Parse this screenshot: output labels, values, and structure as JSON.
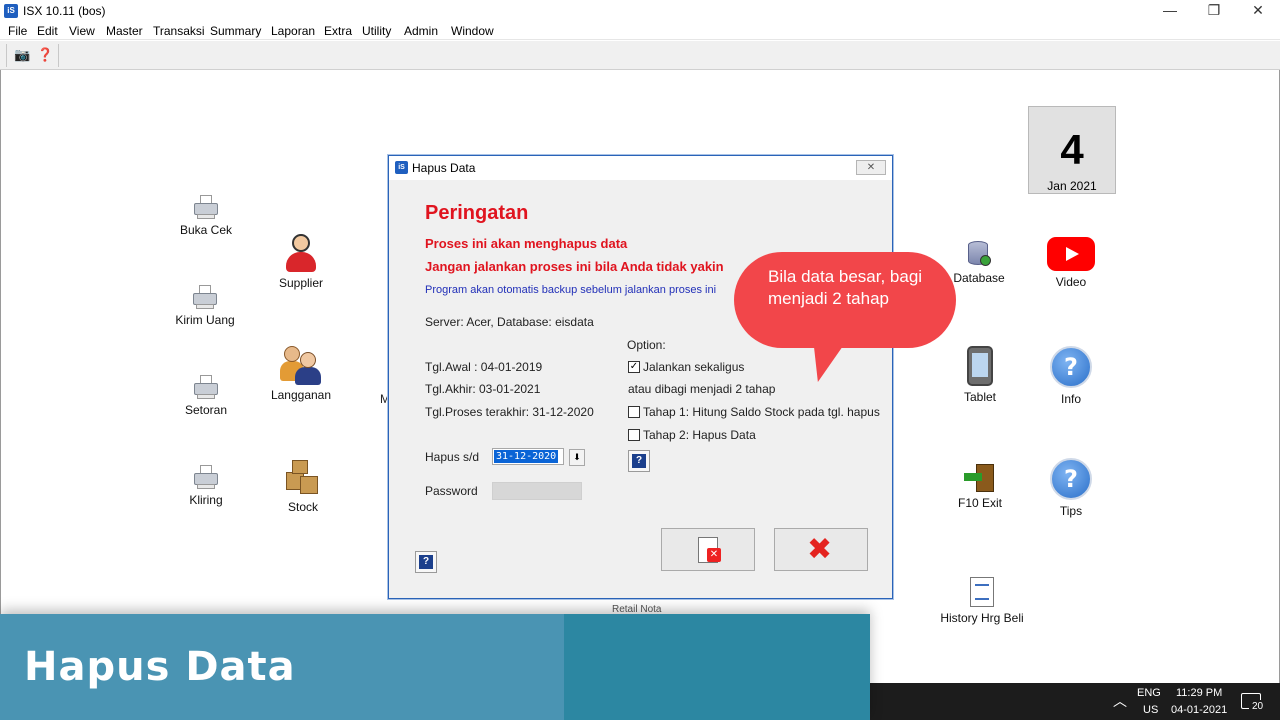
{
  "window": {
    "app_icon": "iS",
    "title": "ISX 10.11 (bos)",
    "minimize": "—",
    "restore": "❐",
    "close": "✕"
  },
  "menu": [
    "File",
    "Edit",
    "View",
    "Master",
    "Transaksi",
    "Summary",
    "Laporan",
    "Extra",
    "Utility",
    "Admin",
    "Window"
  ],
  "toolbar": {
    "icons": [
      "camera-icon",
      "help-key-icon"
    ]
  },
  "desktop_icons": {
    "buka_cek": "Buka Cek",
    "kirim_uang": "Kirim Uang",
    "setoran": "Setoran",
    "kliring": "Kliring",
    "supplier": "Supplier",
    "langganan": "Langganan",
    "stock": "Stock",
    "partial_m": "M",
    "partial_bottom": "Retail Nota",
    "database": "Database",
    "video": "Video",
    "tablet": "Tablet",
    "info": "Info",
    "exit": "F10  Exit",
    "tips": "Tips",
    "history": "History Hrg Beli"
  },
  "date_tile": {
    "day": "4",
    "month_year": "Jan 2021"
  },
  "dialog": {
    "icon": "iS",
    "title": "Hapus Data",
    "close": "✕",
    "heading": "Peringatan",
    "warning1": "Proses ini akan menghapus data",
    "warning2": "Jangan jalankan proses ini bila Anda tidak yakin",
    "note": "Program akan otomatis backup sebelum jalankan proses ini",
    "server": "Server: Acer,  Database: eisdata",
    "tgl_awal": "Tgl.Awal : 04-01-2019",
    "tgl_akhir": "Tgl.Akhir: 03-01-2021",
    "tgl_proses": "Tgl.Proses terakhir:  31-12-2020",
    "hapus_label": "Hapus s/d",
    "hapus_value": "31-12-2020",
    "password_label": "Password",
    "option_label": "Option:",
    "opt_jalankan": "Jalankan sekaligus",
    "opt_jalankan_checked": true,
    "atau": "atau dibagi menjadi 2 tahap",
    "tahap1": "Tahap 1: Hitung Saldo Stock pada tgl. hapus",
    "tahap2": "Tahap 2: Hapus Data",
    "help": "?",
    "check_mark": "✓",
    "dropdown": "⬇"
  },
  "callout": {
    "text": "Bila data besar, bagi menjadi 2 tahap"
  },
  "taskbar": {
    "chevron": "︿",
    "lang1": "ENG",
    "lang2": "US",
    "time": "11:29 PM",
    "date": "04-01-2021",
    "notif_count": "20"
  },
  "banner": {
    "text": "Hapus Data"
  },
  "colors": {
    "warning_red": "#e0141f",
    "note_blue": "#2230b8",
    "callout_red": "#f2464a",
    "banner_teal": "#4a94b3"
  }
}
